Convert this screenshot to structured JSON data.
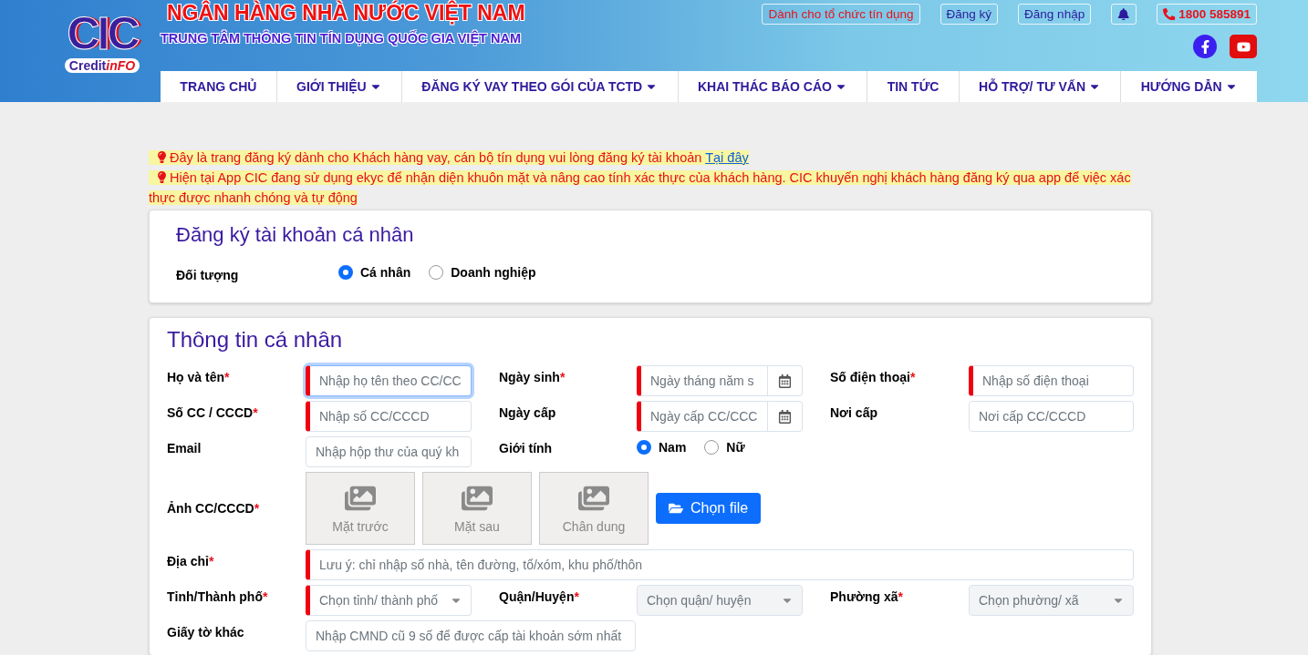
{
  "header": {
    "logo": {
      "mark": "CIC",
      "word_a": "Credit",
      "word_b": "inFO"
    },
    "title": "NGÂN HÀNG NHÀ NƯỚC VIỆT NAM",
    "subtitle": "TRUNG TÂM THÔNG TIN TÍN DỤNG QUỐC GIA VIỆT NAM",
    "top_links": [
      {
        "kind": "accent",
        "label": "Dành cho tổ chức tín dụng"
      },
      {
        "kind": "plain",
        "label": "Đăng ký"
      },
      {
        "kind": "plain",
        "label": "Đăng nhập"
      },
      {
        "kind": "bell"
      },
      {
        "kind": "phone",
        "label": "1800 585891"
      }
    ],
    "nav": [
      {
        "label": "TRANG CHỦ",
        "dropdown": false
      },
      {
        "label": "GIỚI THIỆU",
        "dropdown": true
      },
      {
        "label": "ĐĂNG KÝ VAY THEO GÓI CỦA TCTD",
        "dropdown": true
      },
      {
        "label": "KHAI THÁC BÁO CÁO",
        "dropdown": true
      },
      {
        "label": "TIN TỨC",
        "dropdown": false
      },
      {
        "label": "HỖ TRỢ/ TƯ VẤN",
        "dropdown": true
      },
      {
        "label": "HƯỚNG DẪN",
        "dropdown": true
      }
    ]
  },
  "notices": [
    {
      "text": "Đây là trang đăng ký dành cho Khách hàng vay, cán bộ tín dụng vui lòng đăng ký tài khoản",
      "link": "Tại đây"
    },
    {
      "text": "Hiện tại App CIC đang sử dụng ekyc để nhận diện khuôn mặt và nâng cao tính xác thực của khách hàng. CIC khuyến nghị khách hàng đăng ký qua app để việc xác thực được nhanh chóng và tự động"
    }
  ],
  "account_type": {
    "title": "Đăng ký tài khoản cá nhân",
    "label": "Đối tượng",
    "options": [
      {
        "label": "Cá nhân",
        "selected": true
      },
      {
        "label": "Doanh nghiệp",
        "selected": false
      }
    ]
  },
  "personal_info": {
    "title": "Thông tin cá nhân",
    "rows": [
      [
        {
          "kind": "text",
          "label": "Họ và tên",
          "mark": "*",
          "invalid": true,
          "focused": true,
          "placeholder": "Nhập họ tên theo CC/CC"
        },
        {
          "kind": "date",
          "label": "Ngày sinh",
          "mark": "*",
          "invalid": true,
          "focused": false,
          "placeholder": "Ngày tháng năm s"
        },
        {
          "kind": "text",
          "label": "Số điện thoại",
          "mark": "*",
          "invalid": true,
          "focused": false,
          "placeholder": "Nhập số điện thoại"
        }
      ],
      [
        {
          "kind": "text",
          "label": "Số CC / CCCD",
          "mark": "*",
          "invalid": true,
          "focused": false,
          "placeholder": "Nhập số CC/CCCD"
        },
        {
          "kind": "date",
          "label": "Ngày cấp",
          "invalid": true,
          "focused": false,
          "placeholder": "Ngày cấp CC/CCC"
        },
        {
          "kind": "text",
          "label": "Nơi cấp",
          "invalid": false,
          "focused": false,
          "placeholder": "Nơi cấp CC/CCCD"
        }
      ],
      [
        {
          "kind": "text",
          "label": "Email",
          "invalid": false,
          "focused": false,
          "placeholder": "Nhập hộp thư của quý kh"
        },
        {
          "kind": "radio",
          "label": "Giới tính",
          "options": [
            {
              "label": "Nam",
              "selected": true
            },
            {
              "label": "Nữ",
              "selected": false
            }
          ]
        }
      ],
      [
        {
          "kind": "photos",
          "label": "Ảnh CC/CCCD",
          "mark": "*",
          "photos": [
            "Mặt trước",
            "Mặt sau",
            "Chân dung"
          ],
          "button": "Chọn file"
        }
      ],
      [
        {
          "kind": "address",
          "label": "Địa chỉ",
          "mark": "*",
          "invalid": true,
          "focused": false,
          "placeholder": "Lưu ý: chỉ nhập số nhà, tên đường, tổ/xóm, khu phố/thôn"
        }
      ],
      [
        {
          "kind": "select",
          "label": "Tỉnh/Thành phố",
          "mark": "*",
          "invalid": true,
          "disabled": false,
          "placeholder": "Chọn tỉnh/ thành phố"
        },
        {
          "kind": "select",
          "label": "Quận/Huyện",
          "mark": "*",
          "invalid": false,
          "disabled": true,
          "placeholder": "Chọn quận/ huyện"
        },
        {
          "kind": "select",
          "label": "Phường xã",
          "mark": "*",
          "invalid": false,
          "disabled": true,
          "placeholder": "Chọn phường/ xã"
        }
      ],
      [
        {
          "kind": "long",
          "label": "Giấy tờ khác",
          "invalid": false,
          "focused": false,
          "placeholder": "Nhập CMND cũ 9 số để được cấp tài khoản sớm nhất"
        }
      ]
    ]
  }
}
